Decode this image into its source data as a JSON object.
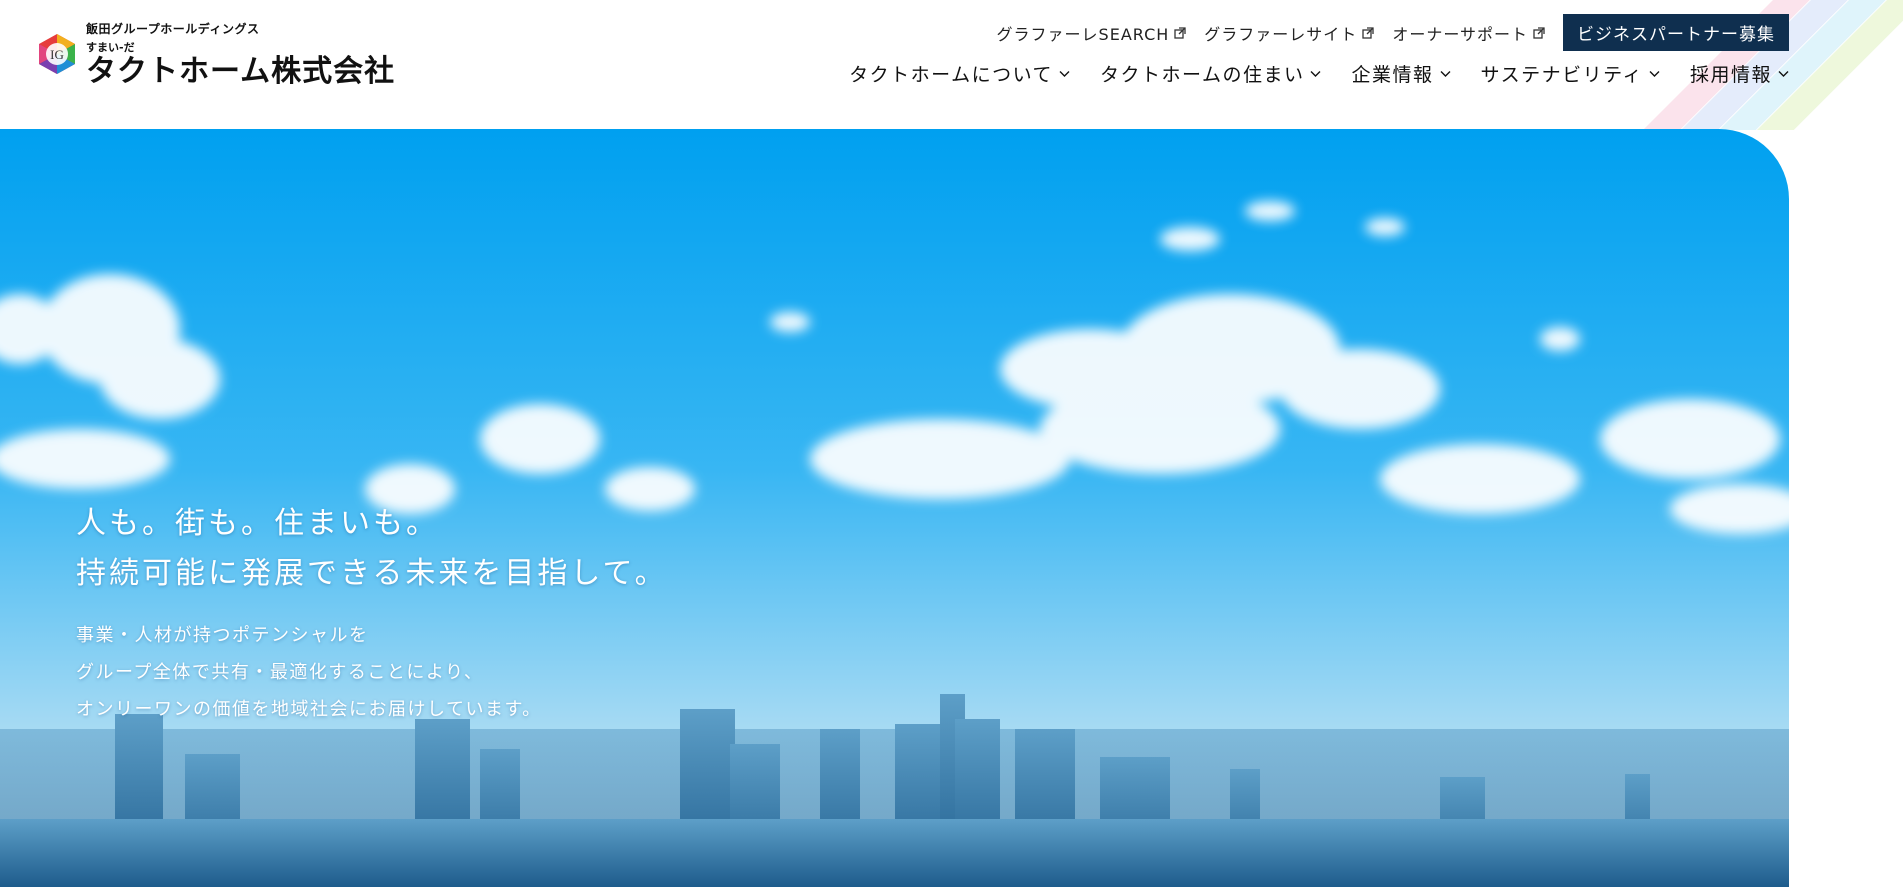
{
  "brand": {
    "group": "飯田グループホールディングス",
    "sub": "すまい-だ",
    "company": "タクトホーム株式会社",
    "mark_text": "IG"
  },
  "utility_links": [
    {
      "label": "グラファーレSEARCH",
      "icon": "external-link-icon"
    },
    {
      "label": "グラファーレサイト",
      "icon": "external-link-icon"
    },
    {
      "label": "オーナーサポート",
      "icon": "external-link-icon"
    }
  ],
  "partner_button": "ビジネスパートナー募集",
  "global_nav": [
    {
      "label": "タクトホームについて",
      "icon": "chevron-down-icon"
    },
    {
      "label": "タクトホームの住まい",
      "icon": "chevron-down-icon"
    },
    {
      "label": "企業情報",
      "icon": "chevron-down-icon"
    },
    {
      "label": "サステナビリティ",
      "icon": "chevron-down-icon"
    },
    {
      "label": "採用情報",
      "icon": "chevron-down-icon"
    }
  ],
  "hero": {
    "catch_line1": "人も。街も。住まいも。",
    "catch_line2": "持続可能に発展できる未来を目指して。",
    "lead_line1": "事業・人材が持つポテンシャルを",
    "lead_line2": "グループ全体で共有・最適化することにより、",
    "lead_line3": "オンリーワンの価値を地域社会にお届けしています。"
  },
  "colors": {
    "accent": "#0f2f4f",
    "sky_top": "#00a0f0",
    "sky_bottom": "#bfe3f4"
  }
}
